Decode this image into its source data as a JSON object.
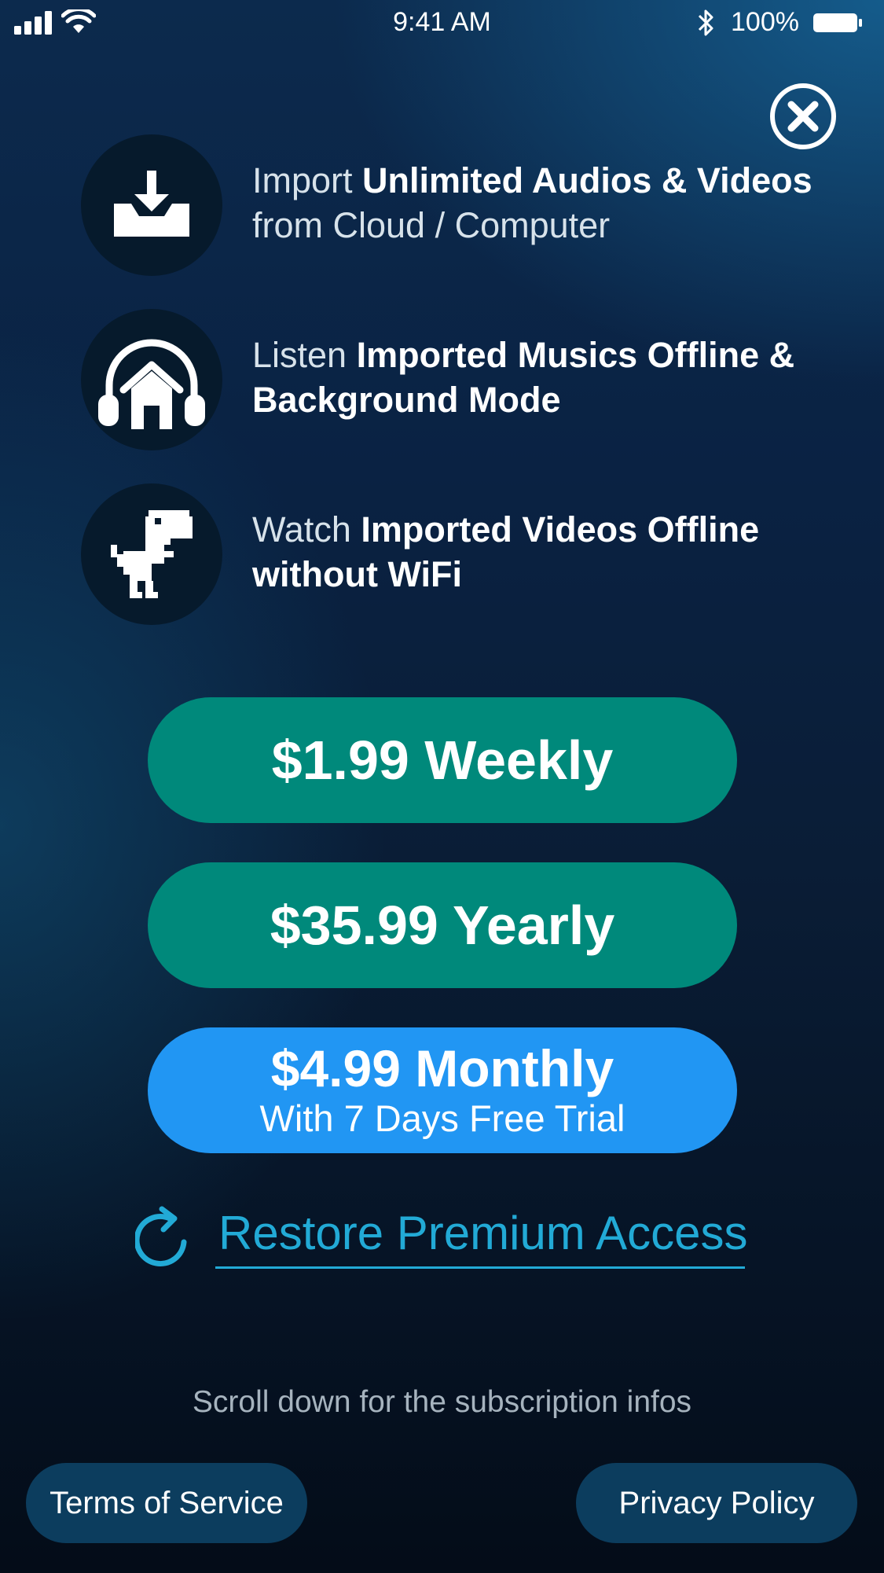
{
  "status_bar": {
    "time": "9:41 AM",
    "battery_percent": "100%",
    "icons": [
      "signal-icon",
      "wifi-icon",
      "bluetooth-icon",
      "battery-icon"
    ]
  },
  "close_icon": "close-circle-icon",
  "features": [
    {
      "icon": "download-tray-icon",
      "pre": "Import ",
      "bold": "Unlimited Audios & Videos",
      "post": " from Cloud / Computer"
    },
    {
      "icon": "headphones-home-icon",
      "pre": "Listen ",
      "bold": "Imported Musics Offline & Background Mode",
      "post": ""
    },
    {
      "icon": "pixel-dinosaur-icon",
      "pre": "Watch ",
      "bold": "Imported Videos Offline without WiFi",
      "post": ""
    }
  ],
  "plans": {
    "weekly": {
      "price": "$1.99 Weekly"
    },
    "yearly": {
      "price": "$35.99 Yearly"
    },
    "monthly": {
      "price": "$4.99 Monthly",
      "subtitle": "With 7 Days Free Trial"
    }
  },
  "restore": {
    "label": "Restore Premium Access",
    "icon": "restore-arrow-icon"
  },
  "scroll_hint": "Scroll down for the subscription infos",
  "footer": {
    "terms": "Terms of Service",
    "privacy": "Privacy Policy"
  },
  "colors": {
    "plan_teal": "#00897b",
    "plan_blue": "#2196f3",
    "accent_cyan": "#22aad6",
    "icon_circle": "#061a2c",
    "footer_button": "#0c3d5e"
  }
}
